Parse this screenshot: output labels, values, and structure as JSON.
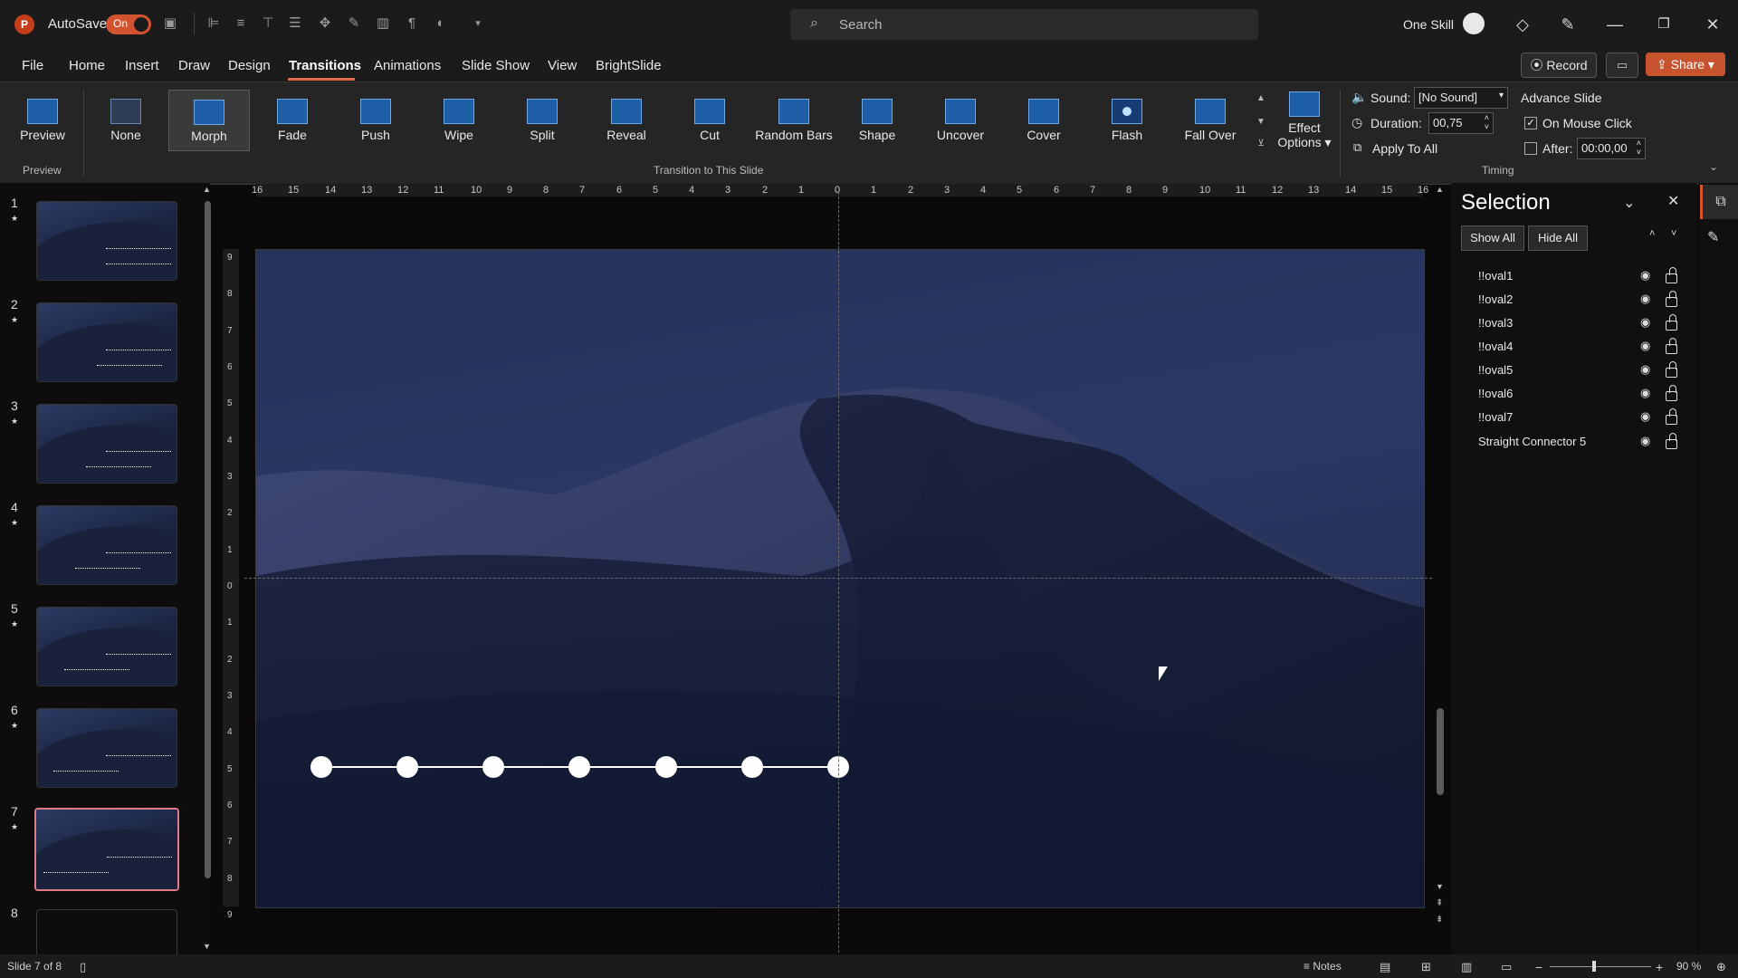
{
  "app": {
    "icon_letter": "P",
    "autosave_label": "AutoSave",
    "autosave_state": "On",
    "search_placeholder": "Search",
    "user_name": "One Skill",
    "accent_color": "#d35230"
  },
  "menu": {
    "items": [
      "File",
      "Home",
      "Insert",
      "Draw",
      "Design",
      "Transitions",
      "Animations",
      "Slide Show",
      "View",
      "BrightSlide"
    ],
    "active": "Transitions",
    "record_label": "Record",
    "share_label": "Share"
  },
  "ribbon": {
    "preview_label": "Preview",
    "preview_group_label": "Preview",
    "transitions": [
      "None",
      "Morph",
      "Fade",
      "Push",
      "Wipe",
      "Split",
      "Reveal",
      "Cut",
      "Random Bars",
      "Shape",
      "Uncover",
      "Cover",
      "Flash",
      "Fall Over"
    ],
    "selected_transition": "Morph",
    "transition_group_label": "Transition to This Slide",
    "effect_options_label_1": "Effect",
    "effect_options_label_2": "Options",
    "sound_label": "Sound:",
    "sound_value": "[No Sound]",
    "duration_label": "Duration:",
    "duration_value": "00,75",
    "apply_all_label": "Apply To All",
    "advance_slide_label": "Advance Slide",
    "on_mouse_click_label": "On Mouse Click",
    "on_mouse_click_checked": true,
    "after_label": "After:",
    "after_value": "00:00,00",
    "after_checked": false,
    "timing_group_label": "Timing"
  },
  "thumbnails": [
    {
      "num": "1",
      "star": "★"
    },
    {
      "num": "2",
      "star": "★"
    },
    {
      "num": "3",
      "star": "★"
    },
    {
      "num": "4",
      "star": "★"
    },
    {
      "num": "5",
      "star": "★"
    },
    {
      "num": "6",
      "star": "★"
    },
    {
      "num": "7",
      "star": "★"
    },
    {
      "num": "8",
      "star": ""
    }
  ],
  "active_slide": 7,
  "rulers": {
    "horizontal": [
      "16",
      "15",
      "14",
      "13",
      "12",
      "11",
      "10",
      "9",
      "8",
      "7",
      "6",
      "5",
      "4",
      "3",
      "2",
      "1",
      "0",
      "1",
      "2",
      "3",
      "4",
      "5",
      "6",
      "7",
      "8",
      "9",
      "10",
      "11",
      "12",
      "13",
      "14",
      "15",
      "16"
    ],
    "vertical": [
      "9",
      "8",
      "7",
      "6",
      "5",
      "4",
      "3",
      "2",
      "1",
      "0",
      "1",
      "2",
      "3",
      "4",
      "5",
      "6",
      "7",
      "8",
      "9"
    ]
  },
  "selection_pane": {
    "title": "Selection",
    "show_all": "Show All",
    "hide_all": "Hide All",
    "items": [
      "!!oval1",
      "!!oval2",
      "!!oval3",
      "!!oval4",
      "!!oval5",
      "!!oval6",
      "!!oval7",
      "Straight Connector 5"
    ]
  },
  "status": {
    "slide_info": "Slide 7 of 8",
    "notes_label": "Notes",
    "zoom": "90 %"
  }
}
